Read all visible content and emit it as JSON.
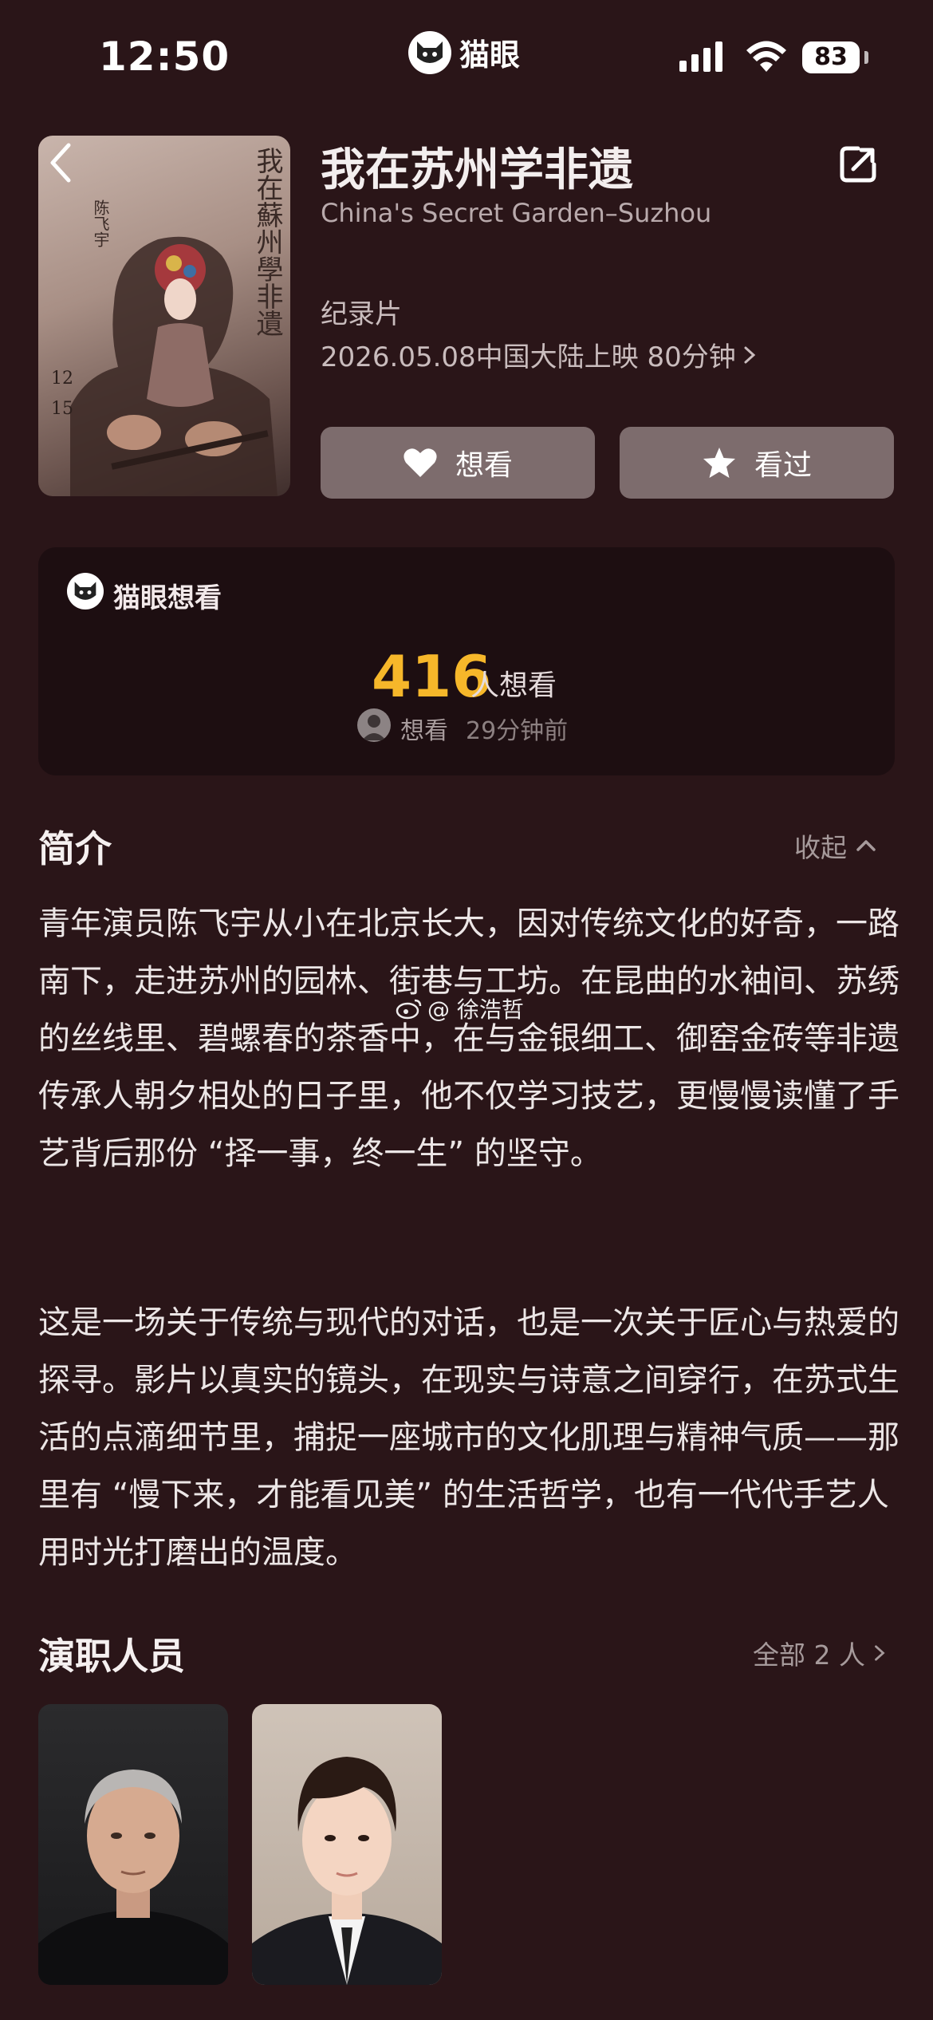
{
  "status_bar": {
    "time": "12:50",
    "app_name": "猫眼",
    "battery": "83",
    "icons": [
      "signal-icon",
      "wifi-icon",
      "battery-icon"
    ]
  },
  "movie": {
    "title": "我在苏州学非遗",
    "english_title": "China's Secret Garden–Suzhou",
    "genre": "纪录片",
    "release": "2026.05.08中国大陆上映 80分钟",
    "poster_text": {
      "title": "我在蘇州學非遺",
      "date_month": "12",
      "date_day": "15",
      "name": "陈飞宇"
    }
  },
  "actions": {
    "want_label": "想看",
    "seen_label": "看过"
  },
  "want_card": {
    "title": "猫眼想看",
    "count": "416",
    "count_label": "人想看",
    "recent_action": "想看",
    "recent_time": "29分钟前"
  },
  "intro": {
    "heading": "简介",
    "collapse_label": "收起",
    "paragraphs": [
      "青年演员陈飞宇从小在北京长大，因对传统文化的好奇，一路南下，走进苏州的园林、街巷与工坊。在昆曲的水袖间、苏绣的丝线里、碧螺春的茶香中，在与金银细工、御窑金砖等非遗传承人朝夕相处的日子里，他不仅学习技艺，更慢慢读懂了手艺背后那份 “择一事，终一生” 的坚守。",
      "这是一场关于传统与现代的对话，也是一次关于匠心与热爱的探寻。影片以真实的镜头，在现实与诗意之间穿行，在苏式生活的点滴细节里，捕捉一座城市的文化肌理与精神气质——那里有 “慢下来，才能看见美” 的生活哲学，也有一代代手艺人用时光打磨出的温度。"
    ],
    "watermark": "@  徐浩哲"
  },
  "cast": {
    "heading": "演职人员",
    "all_label": "全部 2 人"
  },
  "colors": {
    "background": "#2a1518",
    "card": "#1d0e11",
    "button": "#7d6c6d",
    "accent": "#f6b72a"
  }
}
